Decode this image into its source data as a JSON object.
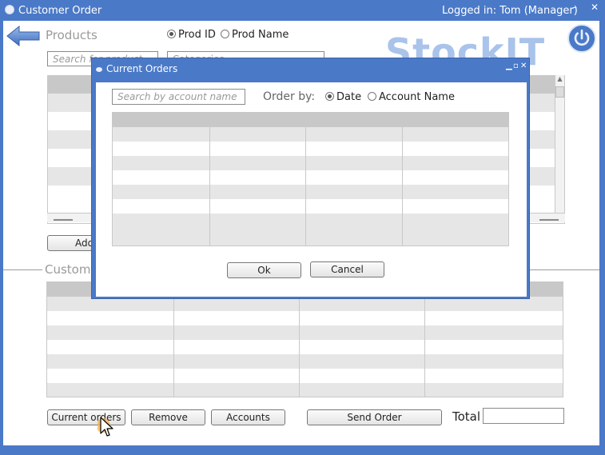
{
  "window": {
    "title": "Customer Order",
    "login_status": "Logged in: Tom (Manager)",
    "minimize_glyph": "–",
    "close_glyph": "✕"
  },
  "products": {
    "label": "Products",
    "search_placeholder": "Search for product",
    "category_placeholder": "Categories",
    "search_mode": {
      "prod_id_label": "Prod ID",
      "prod_name_label": "Prod Name",
      "selected": "Prod ID"
    },
    "add_button_label": "Add"
  },
  "logo": {
    "text": "StockIT"
  },
  "customer_section": {
    "label": "Customer"
  },
  "footer": {
    "current_orders_label": "Current orders",
    "remove_label": "Remove",
    "accounts_label": "Accounts",
    "send_order_label": "Send Order",
    "total_label": "Total",
    "total_value": ""
  },
  "dialog": {
    "title": "Current Orders",
    "search_placeholder": "Search by account name",
    "order_by_label": "Order by:",
    "order_by_options": [
      "Date",
      "Account Name"
    ],
    "order_by_selected": "Date",
    "ok_label": "Ok",
    "cancel_label": "Cancel"
  },
  "colors": {
    "window_chrome": "#4a79c8",
    "grid_header": "#c8c8c8",
    "grid_alt_row": "#e6e6e6",
    "logo": "#a9c3ea"
  },
  "icons": [
    "back-arrow-icon",
    "power-icon",
    "mouse-cursor-icon",
    "app-icon"
  ]
}
